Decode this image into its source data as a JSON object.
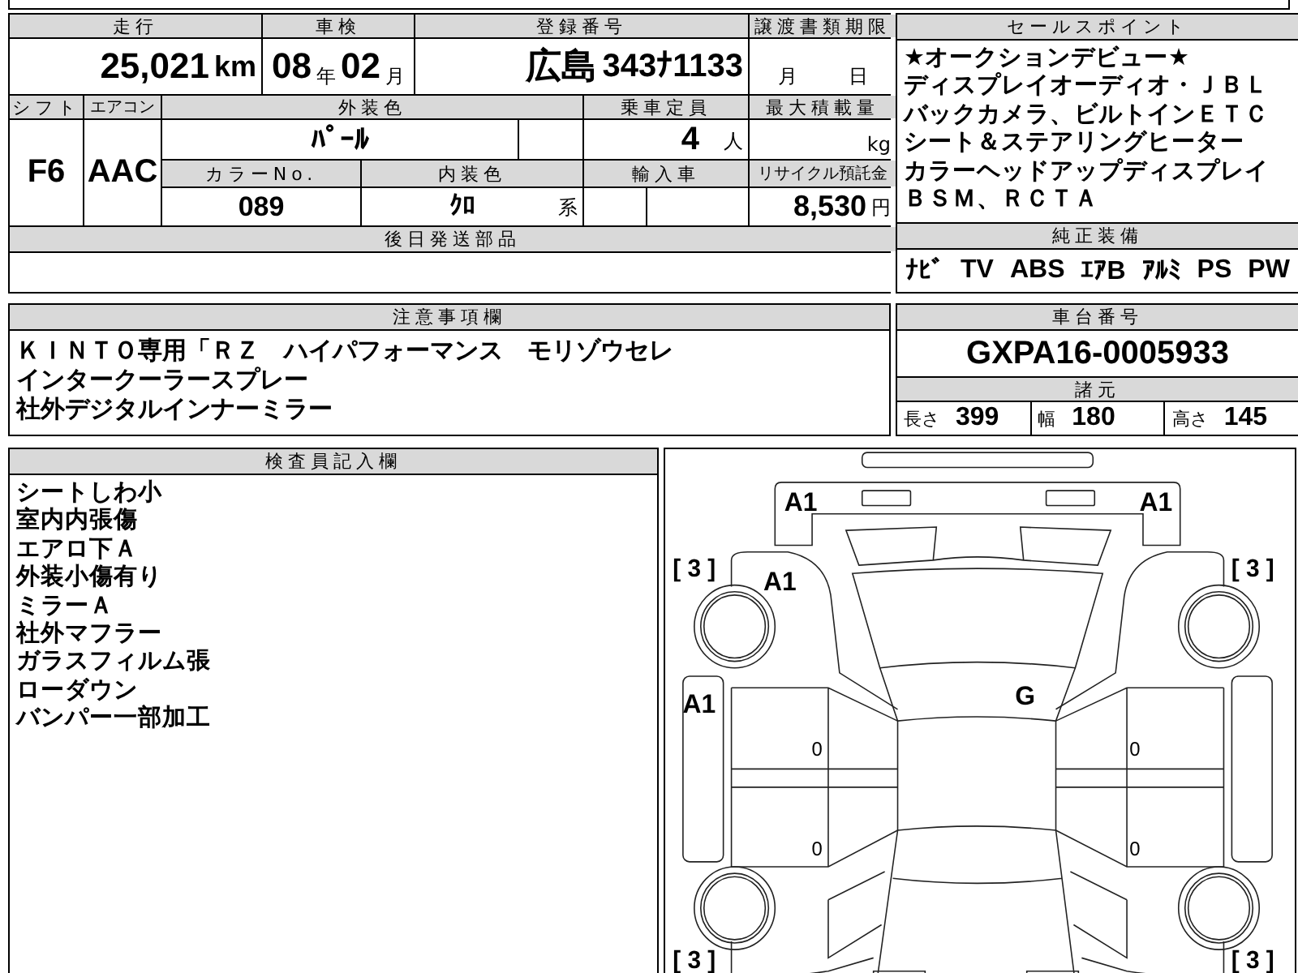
{
  "top_form": {
    "mileage": {
      "label": "走行",
      "value": "25,021",
      "unit": "km"
    },
    "inspection": {
      "label": "車検",
      "year": "08",
      "year_unit": "年",
      "month": "02",
      "month_unit": "月"
    },
    "registration": {
      "label": "登録番号",
      "region": "広島",
      "number": "343ﾅ1133"
    },
    "transfer_deadline": {
      "label": "譲渡書類期限",
      "month_unit": "月",
      "day_unit": "日"
    },
    "shift": {
      "label": "シフト",
      "value": "F6"
    },
    "aircon": {
      "label": "エアコン",
      "value": "AAC"
    },
    "exterior_color": {
      "label": "外装色",
      "value": "ﾊﾟｰﾙ"
    },
    "capacity": {
      "label": "乗車定員",
      "value": "4",
      "unit": "人"
    },
    "max_load": {
      "label": "最大積載量",
      "unit": "kg"
    },
    "color_no": {
      "label": "カラーNo.",
      "value": "089"
    },
    "interior_color": {
      "label": "内装色",
      "value": "ｸﾛ",
      "suffix": "系"
    },
    "imported": {
      "label": "輸入車"
    },
    "recycle": {
      "label": "リサイクル預託金",
      "value": "8,530",
      "unit": "円"
    },
    "later_parts": {
      "label": "後日発送部品"
    }
  },
  "sales_points": {
    "label": "セールスポイント",
    "lines": [
      "★オークションデビュー★",
      "ディスプレイオーディオ・ＪＢＬ",
      "バックカメラ、ビルトインＥＴＣ",
      "シート＆ステアリングヒーター",
      "カラーヘッドアップディスプレイ",
      "ＢＳＭ、ＲＣＴＡ"
    ]
  },
  "standard_equipment": {
    "label": "純正装備",
    "items": [
      "ﾅﾋﾞ",
      "TV",
      "ABS",
      "ｴｱB",
      "ｱﾙﾐ",
      "PS",
      "PW"
    ]
  },
  "notes": {
    "label": "注意事項欄",
    "lines": [
      "ＫＩＮＴＯ専用「ＲＺ　ハイパフォーマンス　モリゾウセレ",
      "インタークーラースプレー",
      "社外デジタルインナーミラー"
    ]
  },
  "chassis": {
    "label": "車台番号",
    "value": "GXPA16-0005933"
  },
  "specs": {
    "label": "諸元",
    "items": [
      {
        "label": "長さ",
        "value": "399"
      },
      {
        "label": "幅",
        "value": "180"
      },
      {
        "label": "高さ",
        "value": "145"
      }
    ]
  },
  "inspector": {
    "label": "検査員記入欄",
    "lines": [
      "シートしわ小",
      "室内内張傷",
      "エアロ下Ａ",
      "外装小傷有り",
      "ミラーＡ",
      "社外マフラー",
      "ガラスフィルム張",
      "ローダウン",
      "バンパー一部加工"
    ]
  },
  "diagram_marks": [
    {
      "kind": "damage",
      "text": "A1"
    },
    {
      "kind": "damage",
      "text": "A1"
    },
    {
      "kind": "damage",
      "text": "A1"
    },
    {
      "kind": "damage",
      "text": "A1"
    },
    {
      "kind": "damage",
      "text": "G"
    },
    {
      "kind": "tread",
      "text": "0"
    },
    {
      "kind": "tread",
      "text": "0"
    },
    {
      "kind": "tread",
      "text": "0"
    },
    {
      "kind": "tread",
      "text": "0"
    },
    {
      "kind": "tire",
      "text": "[ 3 ]"
    },
    {
      "kind": "tire",
      "text": "[ 3 ]"
    },
    {
      "kind": "tire",
      "text": "[ 3 ]"
    },
    {
      "kind": "tire",
      "text": "[ 3 ]"
    }
  ]
}
